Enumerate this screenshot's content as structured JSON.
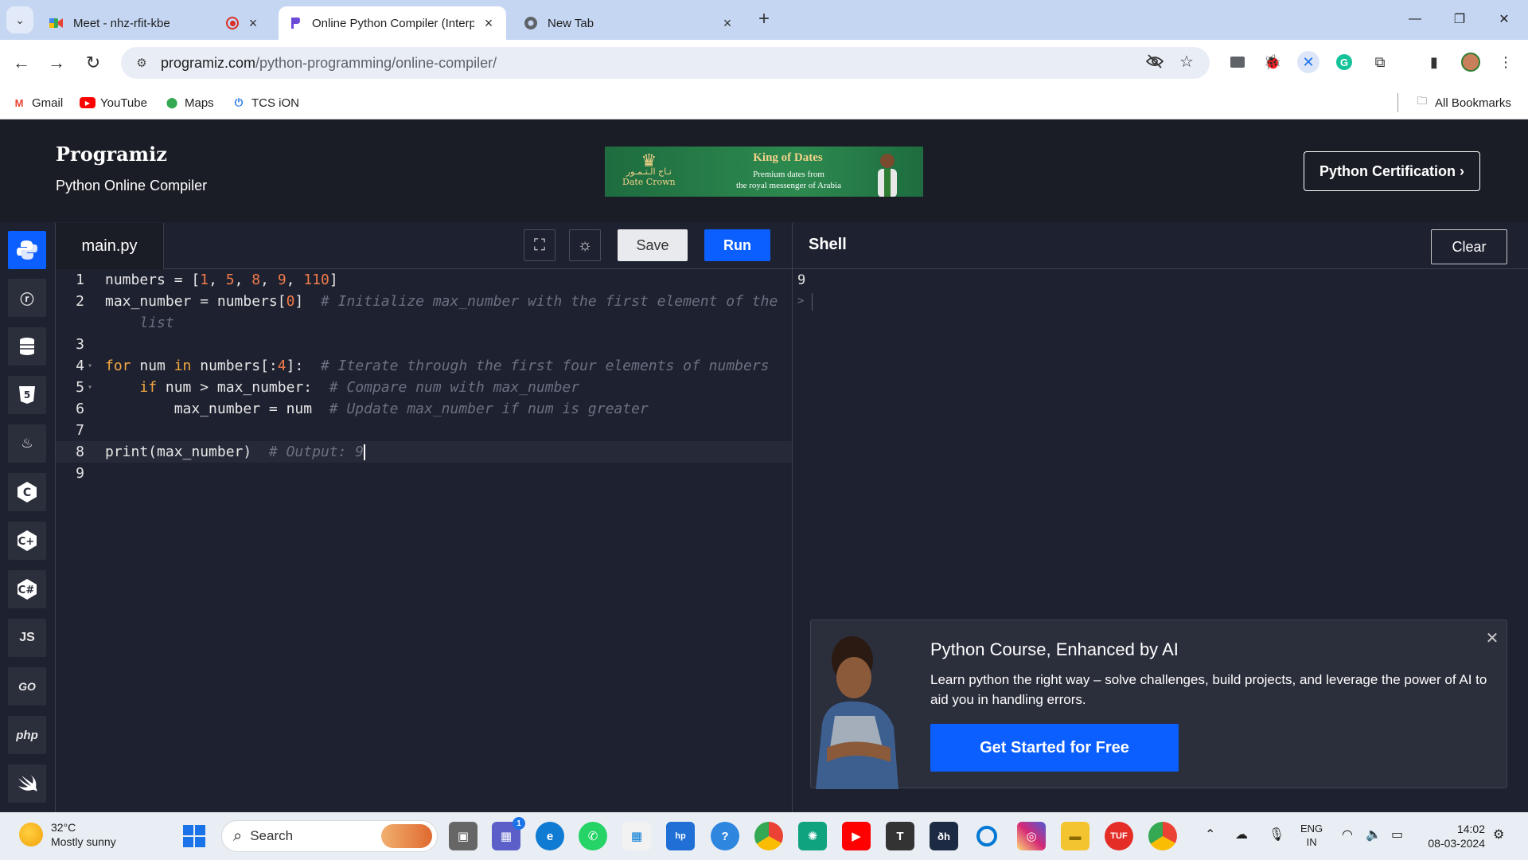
{
  "browser": {
    "tabs": [
      {
        "title": "Meet - nhz-rfit-kbe",
        "favicon": "google-meet-icon"
      },
      {
        "title": "Online Python Compiler (Interp",
        "favicon": "programiz-icon",
        "active": true
      },
      {
        "title": "New Tab",
        "favicon": "chrome-icon"
      }
    ],
    "url_host": "programiz.com",
    "url_path": "/python-programming/online-compiler/",
    "bookmarks": [
      {
        "label": "Gmail",
        "icon": "gmail-icon"
      },
      {
        "label": "YouTube",
        "icon": "youtube-icon"
      },
      {
        "label": "Maps",
        "icon": "maps-icon"
      },
      {
        "label": "TCS iON",
        "icon": "power-icon"
      }
    ],
    "all_bookmarks_label": "All Bookmarks"
  },
  "header": {
    "logo": "Programiz",
    "subtitle": "Python Online Compiler",
    "ad": {
      "title": "King of Dates",
      "subtitle_line1": "Premium dates from",
      "subtitle_line2": "the royal messenger of Arabia",
      "brand_arabic": "تـاج الـتـمـور",
      "brand": "Date Crown"
    },
    "certification_label": "Python Certification ›"
  },
  "languages": [
    "python-icon",
    "r-icon",
    "sql-icon",
    "html5-icon",
    "java-icon",
    "c-icon",
    "cpp-icon",
    "csharp-icon",
    "JS",
    "GO",
    "php",
    "swift-icon"
  ],
  "editor": {
    "filename": "main.py",
    "save_label": "Save",
    "run_label": "Run"
  },
  "code": {
    "line_numbers": [
      "1",
      "2",
      "3",
      "4",
      "5",
      "6",
      "7",
      "8",
      "9"
    ],
    "line1_a": "numbers = [",
    "line1_n1": "1",
    "line1_n2": "5",
    "line1_n3": "8",
    "line1_n4": "9",
    "line1_n5": "110",
    "line1_b": "]",
    "line2_a": "max_number = numbers[",
    "line2_n": "0",
    "line2_b": "]",
    "line2_cmt": "# Initialize max_number with the first element of the",
    "line2_cmt_wrap": "list",
    "line4_kw1": "for",
    "line4_a": " num ",
    "line4_kw2": "in",
    "line4_b": " numbers[:",
    "line4_n": "4",
    "line4_c": "]:",
    "line4_cmt": "# Iterate through the first four elements of numbers",
    "line5_kw": "if",
    "line5_a": " num > max_number:",
    "line5_cmt": "# Compare num with max_number",
    "line6_a": "max_number = num",
    "line6_cmt": "# Update max_number if num is greater",
    "line8_a": "print(max_number)",
    "line8_cmt": "# Output: 9"
  },
  "shell": {
    "title": "Shell",
    "clear_label": "Clear",
    "output": "9",
    "prompt": ">"
  },
  "promo": {
    "title": "Python Course, Enhanced by AI",
    "text": "Learn python the right way – solve challenges, build projects, and leverage the power of AI to aid you in handling errors.",
    "cta": "Get Started for Free"
  },
  "taskbar": {
    "temperature": "32°C",
    "weather": "Mostly sunny",
    "search_placeholder": "Search",
    "lang1": "ENG",
    "lang2": "IN",
    "time": "14:02",
    "date": "08-03-2024",
    "teams_badge": "1"
  },
  "colors": {
    "accent": "#0b5fff",
    "editor_bg": "#1e2130",
    "header_bg": "#1b1d26",
    "keyword": "#f4a742",
    "number": "#f07a4a",
    "comment": "#6b7080"
  }
}
